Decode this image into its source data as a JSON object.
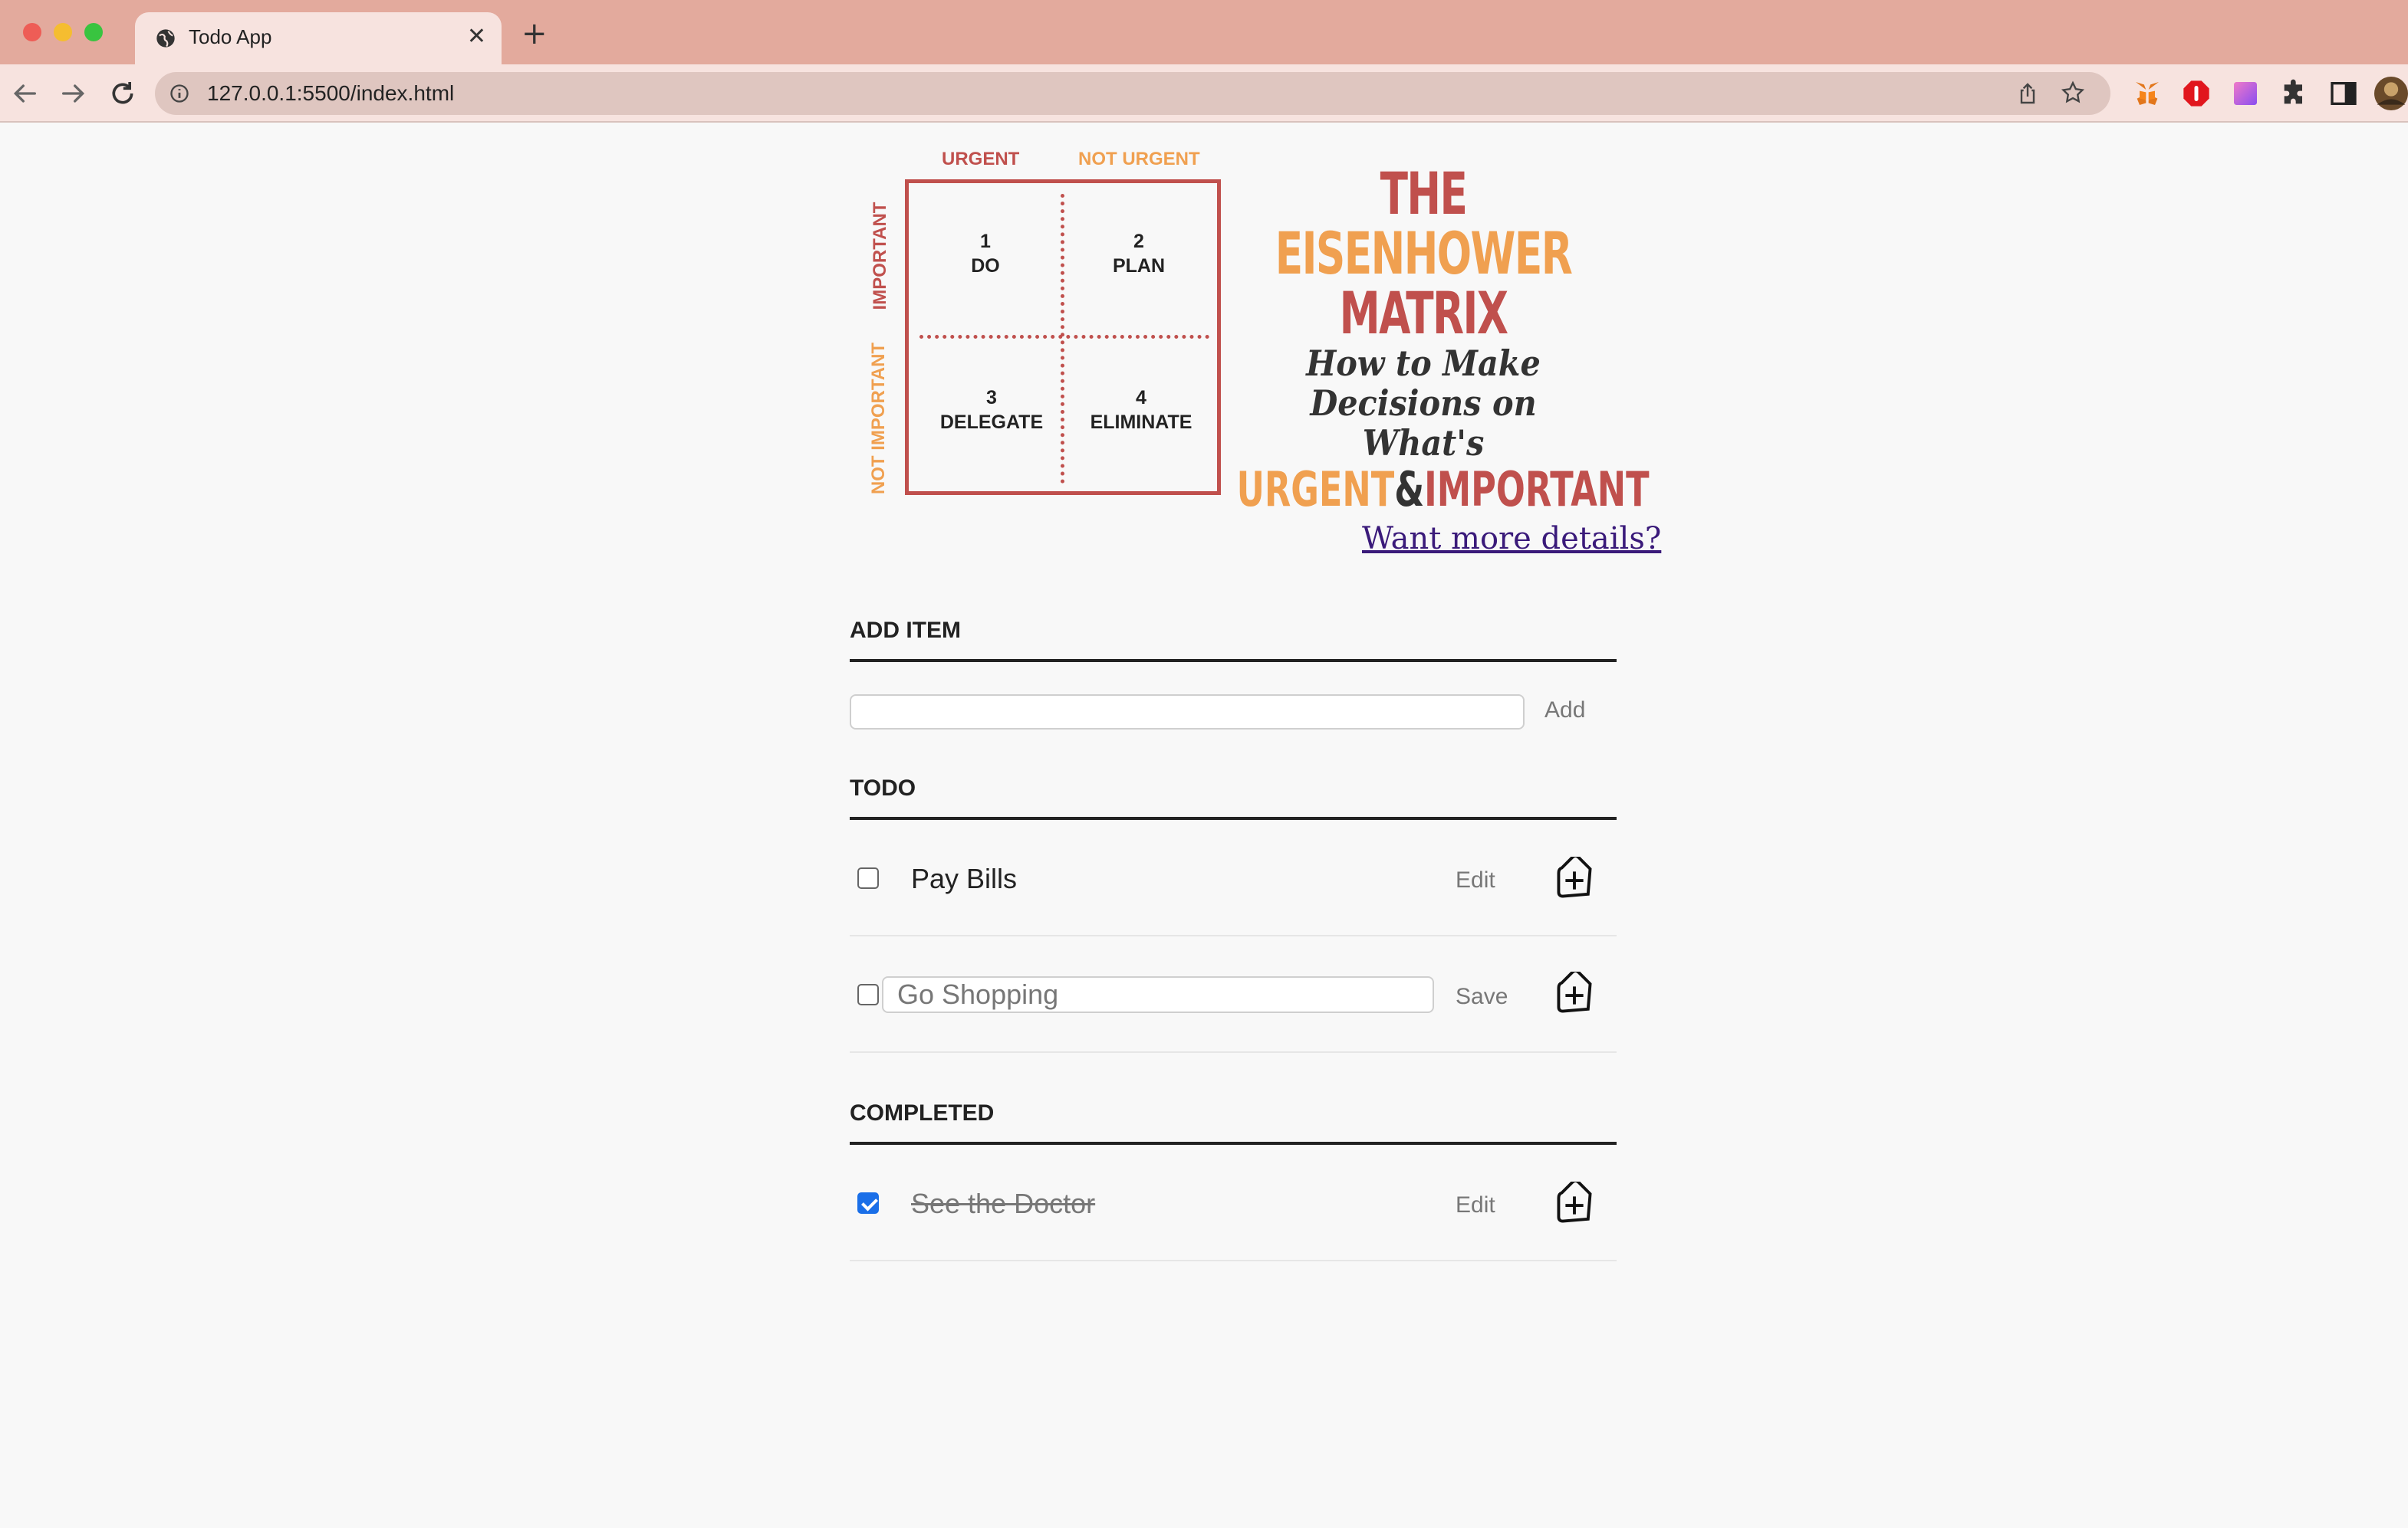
{
  "browser": {
    "tab_title": "Todo App",
    "url": "127.0.0.1:5500/index.html"
  },
  "matrix": {
    "col_urgent": "URGENT",
    "col_not_urgent": "NOT URGENT",
    "row_important": "IMPORTANT",
    "row_not_important": "NOT IMPORTANT",
    "q1_num": "1",
    "q1_label": "DO",
    "q2_num": "2",
    "q2_label": "PLAN",
    "q3_num": "3",
    "q3_label": "DELEGATE",
    "q4_num": "4",
    "q4_label": "ELIMINATE",
    "title_1": "THE",
    "title_2": "EISENHOWER",
    "title_3": "MATRIX",
    "subtitle_1": "How to Make",
    "subtitle_2": "Decisions on What's",
    "bottom_urgent": "URGENT",
    "bottom_amp": "&",
    "bottom_important": "IMPORTANT",
    "colors": {
      "dark": "#c0504d",
      "orange": "#f0a050"
    }
  },
  "details_link": "Want more details?",
  "add_section": {
    "title": "ADD ITEM",
    "input_value": "",
    "button_label": "Add"
  },
  "todo_section": {
    "title": "TODO",
    "items": [
      {
        "text": "Pay Bills",
        "action": "Edit",
        "checked": false
      },
      {
        "text": "Go Shopping",
        "action": "Save",
        "checked": false,
        "editing": true
      }
    ]
  },
  "completed_section": {
    "title": "COMPLETED",
    "items": [
      {
        "text": "See the Doctor",
        "action": "Edit",
        "checked": true
      }
    ]
  }
}
